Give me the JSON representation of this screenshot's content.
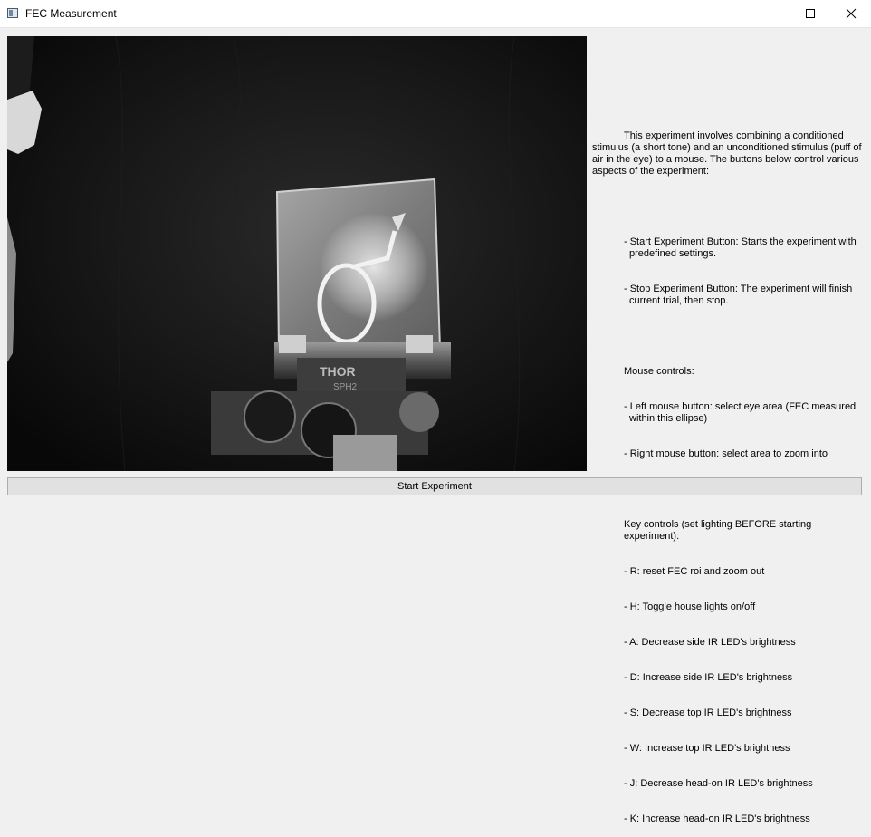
{
  "window": {
    "title": "FEC Measurement",
    "icon": "app-window-icon",
    "controls": [
      "minimize-icon",
      "maximize-icon",
      "close-icon"
    ]
  },
  "camera": {
    "description_icon": "camera-feed"
  },
  "instructions": {
    "intro": "This experiment involves combining a conditioned stimulus (a short tone) and an unconditioned stimulus (puff of air in the eye) to a mouse. The buttons below control various aspects of the experiment:",
    "button_items": [
      "- Start Experiment Button: Starts the experiment with predefined settings.",
      "- Stop Experiment Button: The experiment will finish current trial, then stop."
    ],
    "mouse_heading": "Mouse controls:",
    "mouse_items": [
      "- Left mouse button: select eye area (FEC measured within this ellipse)",
      "- Right mouse button: select area to zoom into"
    ],
    "key_heading": "Key controls (set lighting BEFORE starting experiment):",
    "key_items": [
      "- R: reset FEC roi and zoom out",
      "- H: Toggle house lights on/off",
      "- A: Decrease side IR LED's brightness",
      "- D: Increase side IR LED's brightness",
      "- S: Decrease top IR LED's brightness",
      "- W: Increase top IR LED's brightness",
      "- J: Decrease head-on IR LED's brightness",
      "- K: Increase head-on IR LED's brightness"
    ]
  },
  "start_button": {
    "label": "Start Experiment"
  }
}
